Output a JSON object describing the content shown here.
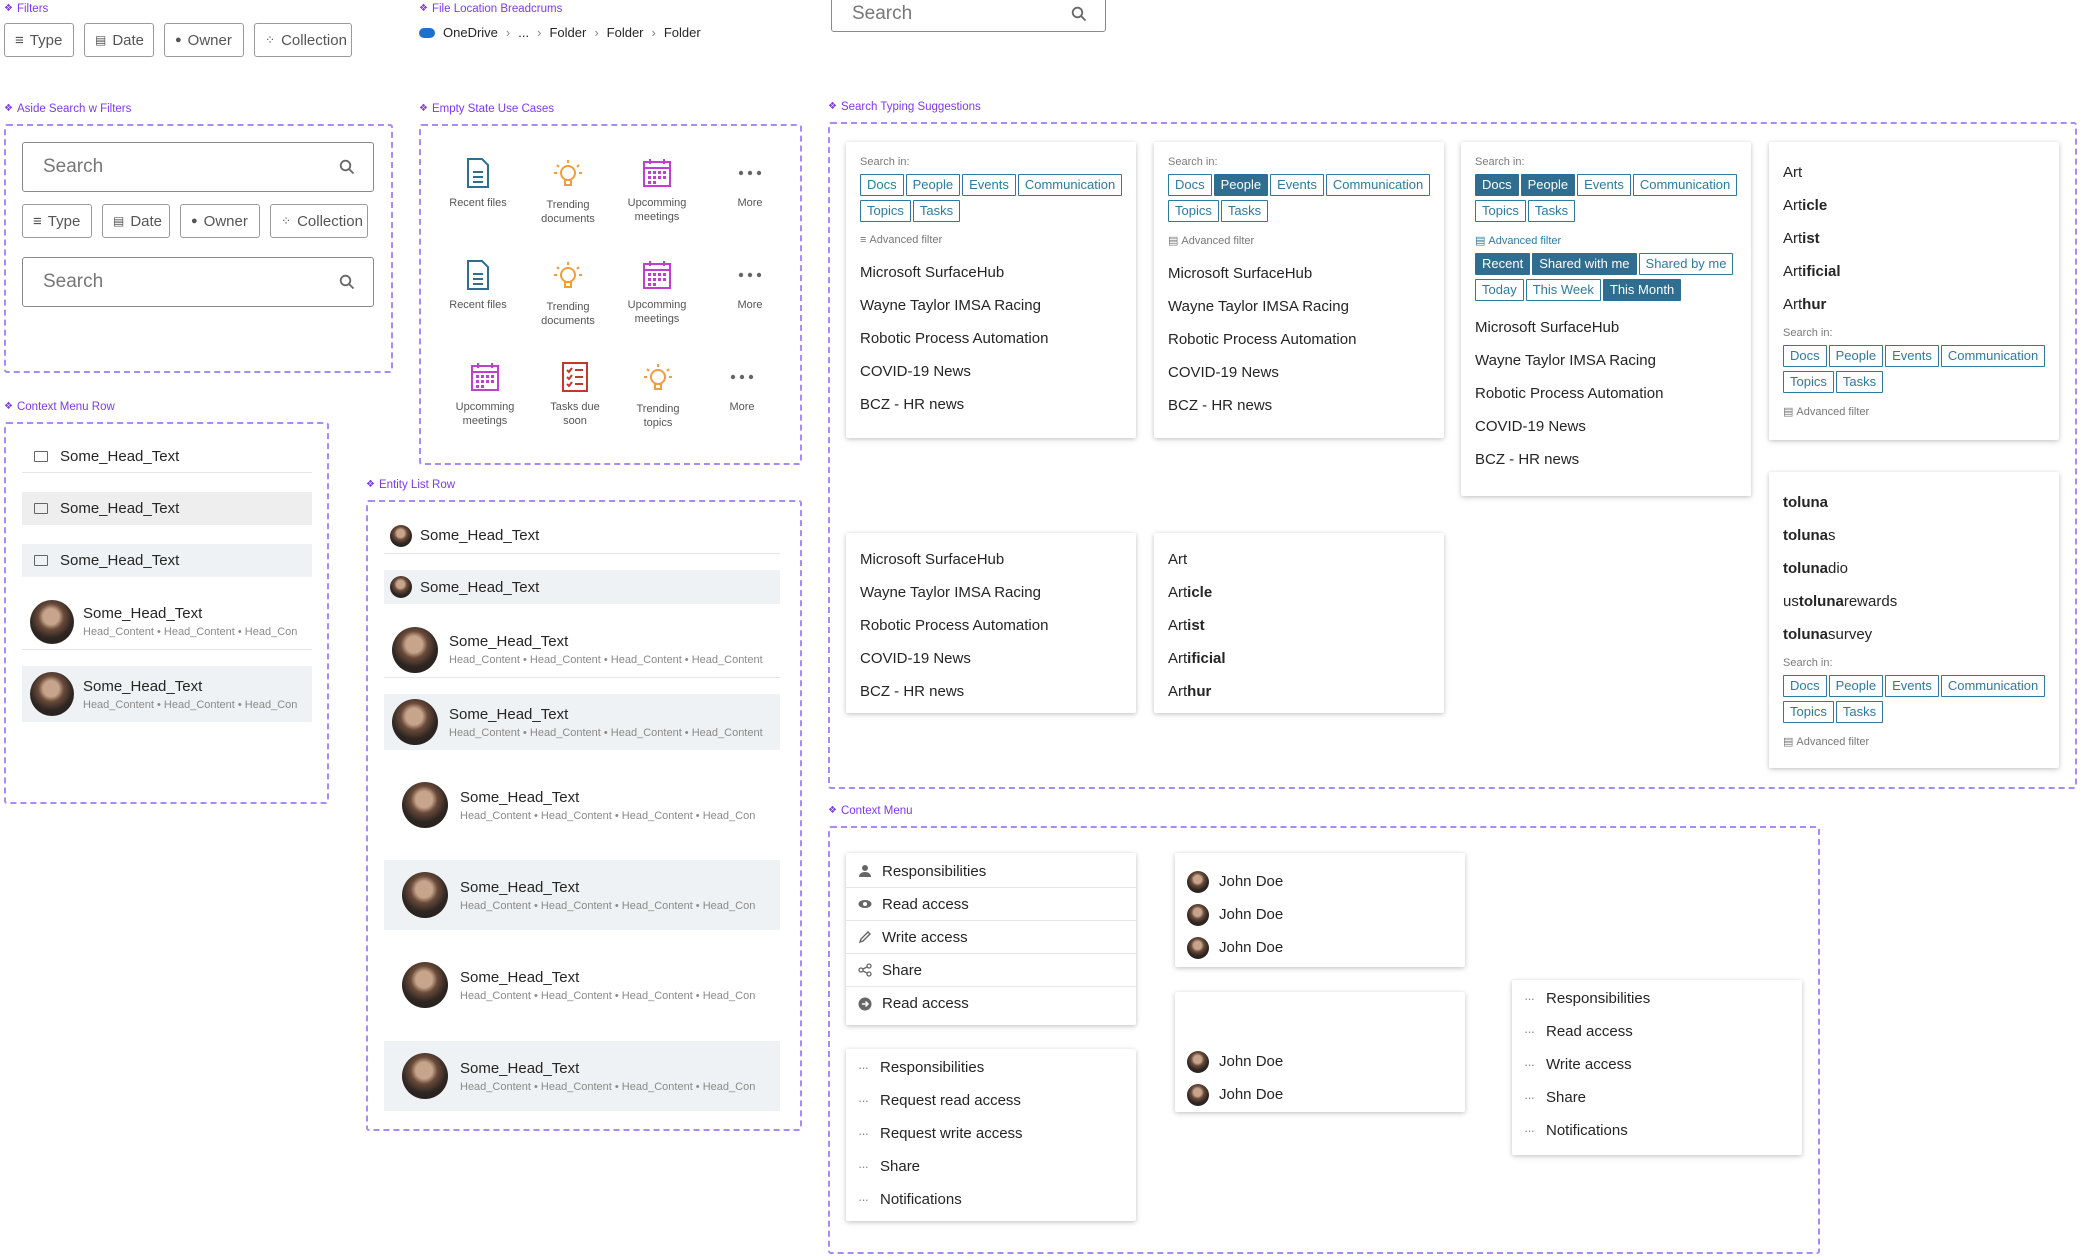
{
  "sections": {
    "filters": "Filters",
    "breadcrumbs": "File Location Breadcrums",
    "aside_search": "Aside Search w Filters",
    "empty_state": "Empty State Use Cases",
    "typing_suggestions": "Search Typing Suggestions",
    "context_menu_row": "Context Menu Row",
    "entity_list_row": "Entity List Row",
    "context_menu": "Context Menu"
  },
  "filters": [
    "Type",
    "Date",
    "Owner",
    "Collection"
  ],
  "breadcrumb": {
    "root": "OneDrive",
    "items": [
      "...",
      "Folder",
      "Folder",
      "Folder"
    ]
  },
  "search": {
    "placeholder": "Search"
  },
  "empty_state": {
    "rows": [
      [
        {
          "icon": "doc",
          "label": "Recent files"
        },
        {
          "icon": "bulb",
          "label": "Trending documents"
        },
        {
          "icon": "calendar",
          "label": "Upcomming meetings"
        },
        {
          "icon": "dots",
          "label": "More"
        }
      ],
      [
        {
          "icon": "doc",
          "label": "Recent files"
        },
        {
          "icon": "bulb",
          "label": "Trending documents"
        },
        {
          "icon": "calendar",
          "label": "Upcomming meetings"
        },
        {
          "icon": "dots",
          "label": "More"
        }
      ],
      [
        {
          "icon": "calendar",
          "label": "Upcomming meetings"
        },
        {
          "icon": "tasks",
          "label": "Tasks due soon"
        },
        {
          "icon": "bulb",
          "label": "Trending topics"
        },
        {
          "icon": "dots",
          "label": "More"
        }
      ]
    ]
  },
  "suggestions": {
    "search_in": "Search in:",
    "tags": [
      "Docs",
      "People",
      "Events",
      "Communication",
      "Topics",
      "Tasks"
    ],
    "advanced_filter": "Advanced filter",
    "time_tags": [
      "Recent",
      "Shared with me",
      "Shared by me",
      "Today",
      "This Week",
      "This Month"
    ],
    "results": [
      "Microsoft SurfaceHub",
      "Wayne Taylor IMSA Racing",
      "Robotic Process Automation",
      "COVID-19 News",
      "BCZ - HR news"
    ],
    "art_words": [
      {
        "bold": "",
        "prefix": "Art",
        "rest": ""
      },
      {
        "prefix": "Art",
        "rest": "icle"
      },
      {
        "prefix": "Art",
        "rest": "ist"
      },
      {
        "prefix": "Art",
        "rest": "ificial"
      },
      {
        "prefix": "Art",
        "rest": "hur"
      }
    ],
    "toluna": [
      {
        "pre": "",
        "bold": "toluna",
        "post": ""
      },
      {
        "pre": "",
        "bold": "toluna",
        "post": "s"
      },
      {
        "pre": "",
        "bold": "toluna",
        "post": "dio"
      },
      {
        "pre": "us ",
        "bold": "toluna",
        "post": " rewards"
      },
      {
        "pre": "",
        "bold": "toluna",
        "post": " survey"
      }
    ]
  },
  "cm_row": {
    "head": "Some_Head_Text",
    "content": "Head_Content  •  Head_Content  •  Head_Con"
  },
  "entity_row": {
    "head": "Some_Head_Text",
    "content_full": "Head_Content  •  Head_Content  •  Head_Content  •  Head_Content",
    "content_cut": "Head_Content  •  Head_Content  •  Head_Content  •  Head_Con"
  },
  "context_menu": {
    "menu1": [
      {
        "icon": "person",
        "label": "Responsibilities"
      },
      {
        "icon": "eye",
        "label": "Read access"
      },
      {
        "icon": "pencil",
        "label": "Write access"
      },
      {
        "icon": "share",
        "label": "Share"
      },
      {
        "icon": "arrow",
        "label": "Read access"
      }
    ],
    "menu2": [
      "Responsibilities",
      "Request read access",
      "Request write access",
      "Share",
      "Notifications"
    ],
    "people": [
      "John Doe",
      "John Doe",
      "John Doe"
    ],
    "people2": [
      "John Doe",
      "John Doe"
    ],
    "menu3": [
      "Responsibilities",
      "Read access",
      "Write access",
      "Share",
      "Notifications"
    ]
  }
}
